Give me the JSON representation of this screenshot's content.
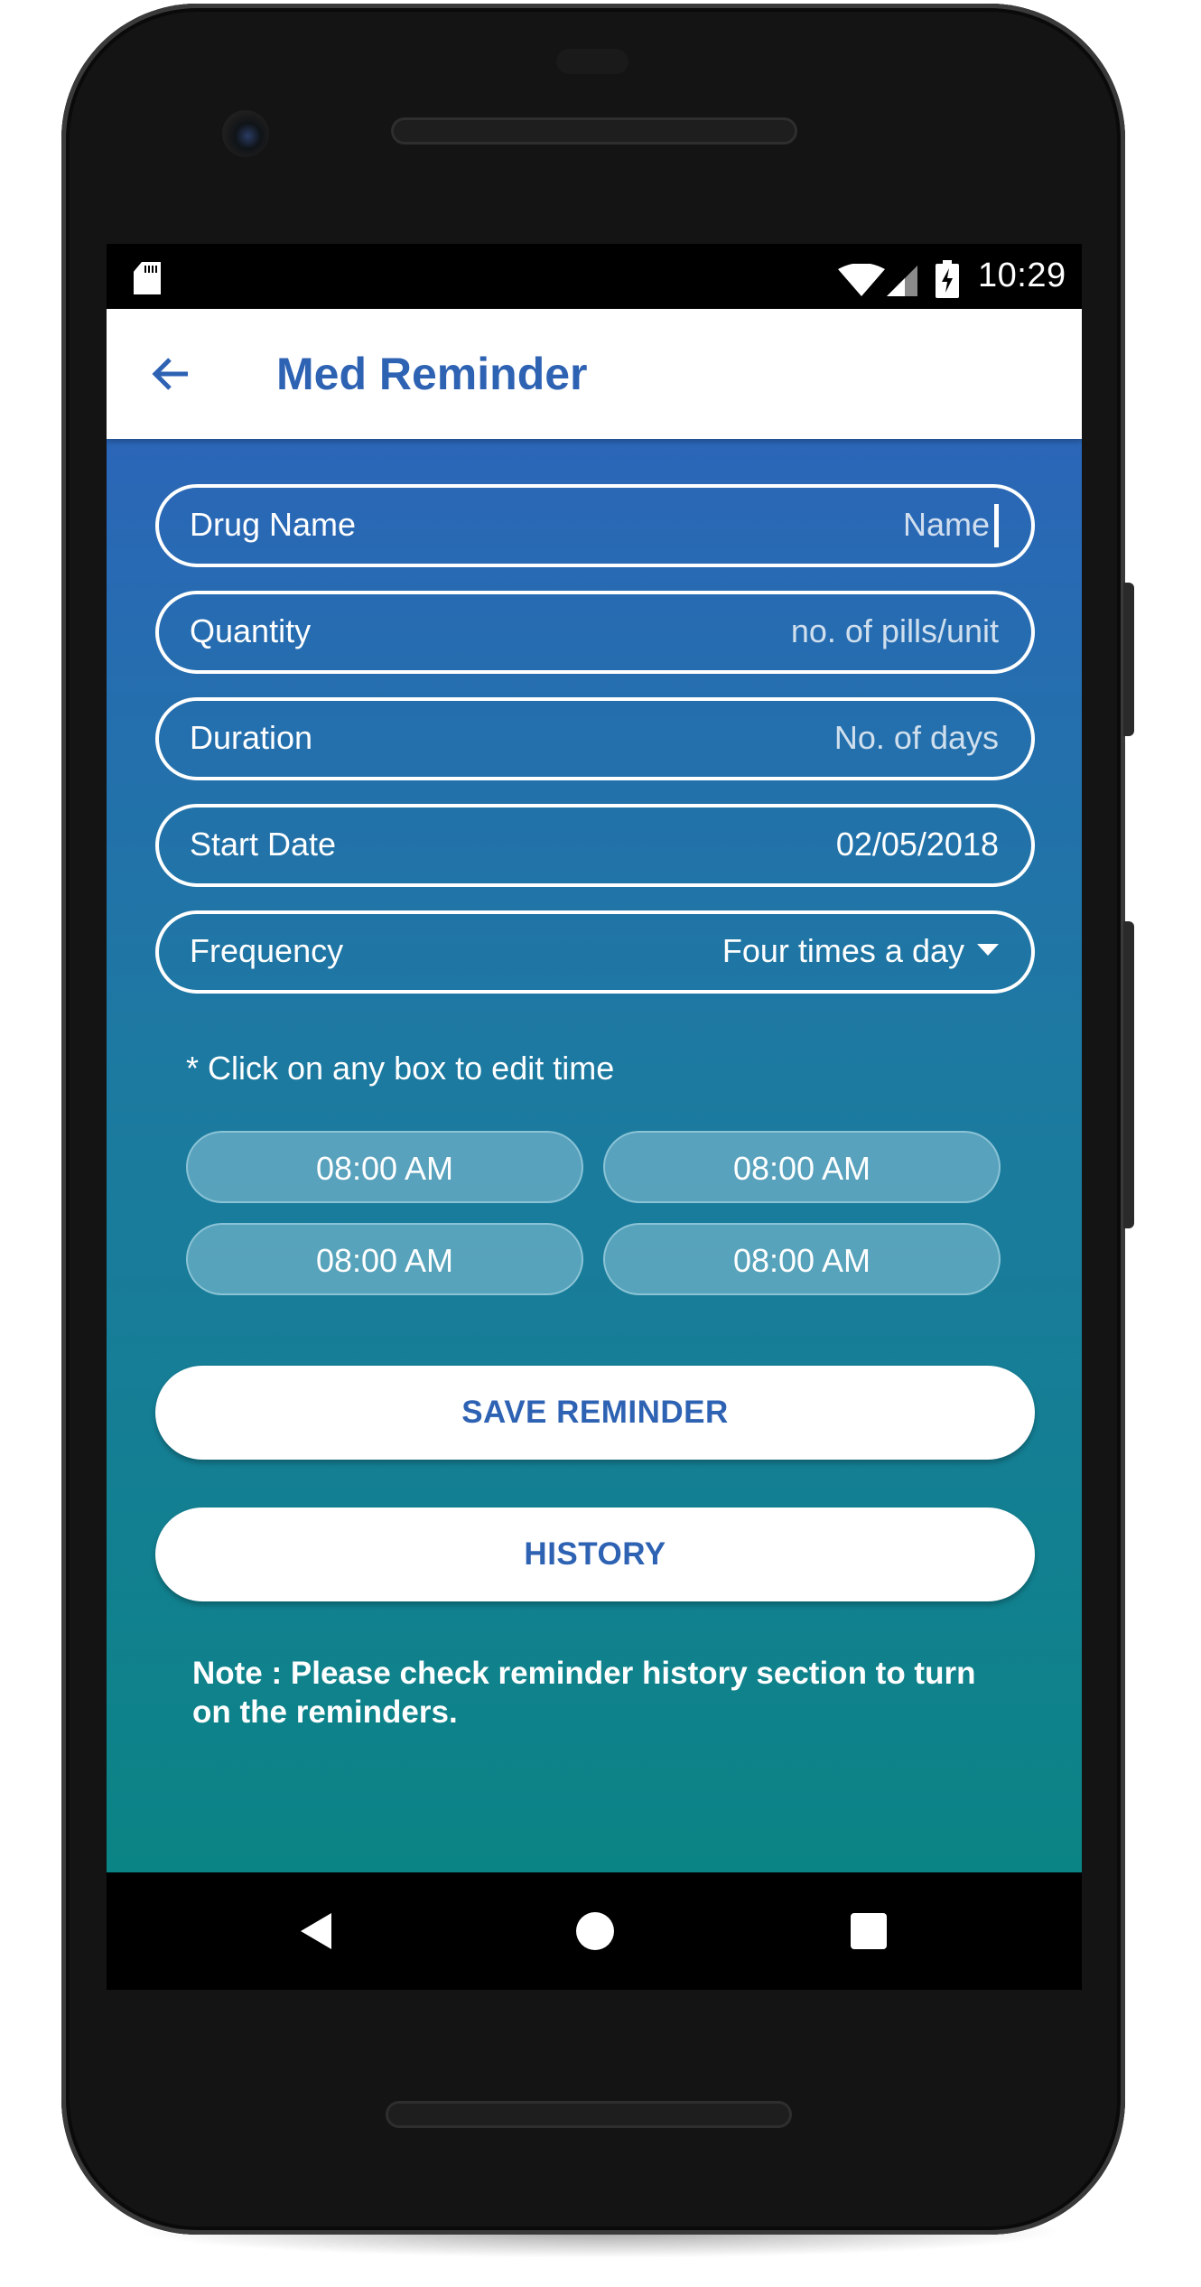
{
  "status_bar": {
    "time": "10:29",
    "icons": [
      "sd-card-icon",
      "wifi-icon",
      "cell-signal-icon",
      "battery-charging-icon"
    ]
  },
  "app_bar": {
    "title": "Med Reminder",
    "back_icon": "arrow-left-icon"
  },
  "form": {
    "drug_name": {
      "label": "Drug Name",
      "placeholder": "Name"
    },
    "quantity": {
      "label": "Quantity",
      "placeholder": "no. of pills/unit"
    },
    "duration": {
      "label": "Duration",
      "placeholder": "No. of days"
    },
    "start_date": {
      "label": "Start Date",
      "value": "02/05/2018"
    },
    "frequency": {
      "label": "Frequency",
      "value": "Four times a day"
    }
  },
  "times": {
    "hint": "* Click on any box to edit time",
    "slots": [
      "08:00 AM",
      "08:00 AM",
      "08:00 AM",
      "08:00 AM"
    ]
  },
  "actions": {
    "save_label": "SAVE REMINDER",
    "history_label": "HISTORY"
  },
  "note": "Note : Please check reminder history section to turn on the reminders.",
  "colors": {
    "accent": "#2e62b3",
    "gradient_top": "#2b66b8",
    "gradient_bottom": "#0b8485"
  },
  "nav_bar": {
    "icons": [
      "nav-back-icon",
      "nav-home-icon",
      "nav-recents-icon"
    ]
  }
}
